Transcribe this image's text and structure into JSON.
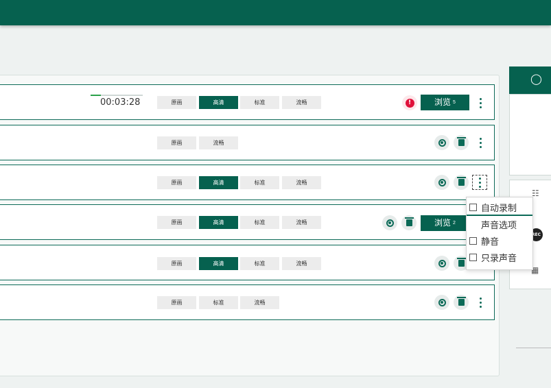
{
  "timer": {
    "elapsed": "00:03:28",
    "progress_fraction": 0.2
  },
  "quality": {
    "original": "原画",
    "hd": "高清",
    "sd": "标准",
    "smooth": "流畅"
  },
  "rows": [
    {
      "buttons": [
        "原画",
        "高清",
        "标准",
        "流畅"
      ],
      "active": "高清",
      "view_label": "浏览",
      "view_count": "5",
      "alert": "!"
    },
    {
      "buttons": [
        "原画",
        "流畅"
      ]
    },
    {
      "buttons": [
        "原画",
        "高清",
        "标准",
        "流畅"
      ],
      "active": "高清"
    },
    {
      "buttons": [
        "原画",
        "高清",
        "标准",
        "流畅"
      ],
      "active": "高清",
      "view_label": "浏览",
      "view_count": "2"
    },
    {
      "buttons": [
        "原画",
        "高清",
        "标准",
        "流畅"
      ],
      "active": "高清"
    },
    {
      "buttons": [
        "原画",
        "标准",
        "流畅"
      ]
    }
  ],
  "context_menu": {
    "auto_record": "自动录制",
    "audio_options": "声音选项",
    "mute": "静音",
    "audio_only": "只录声音"
  },
  "sidebar": {
    "rec_badge": "REC"
  },
  "colors": {
    "primary": "#06614f",
    "alert": "#e0103a",
    "progress": "#2aa14a"
  },
  "icons": [
    "record-icon",
    "trash-icon",
    "more-vertical-icon",
    "alert-icon",
    "user-circle-icon",
    "database-icon",
    "rec-icon",
    "network-icon"
  ]
}
